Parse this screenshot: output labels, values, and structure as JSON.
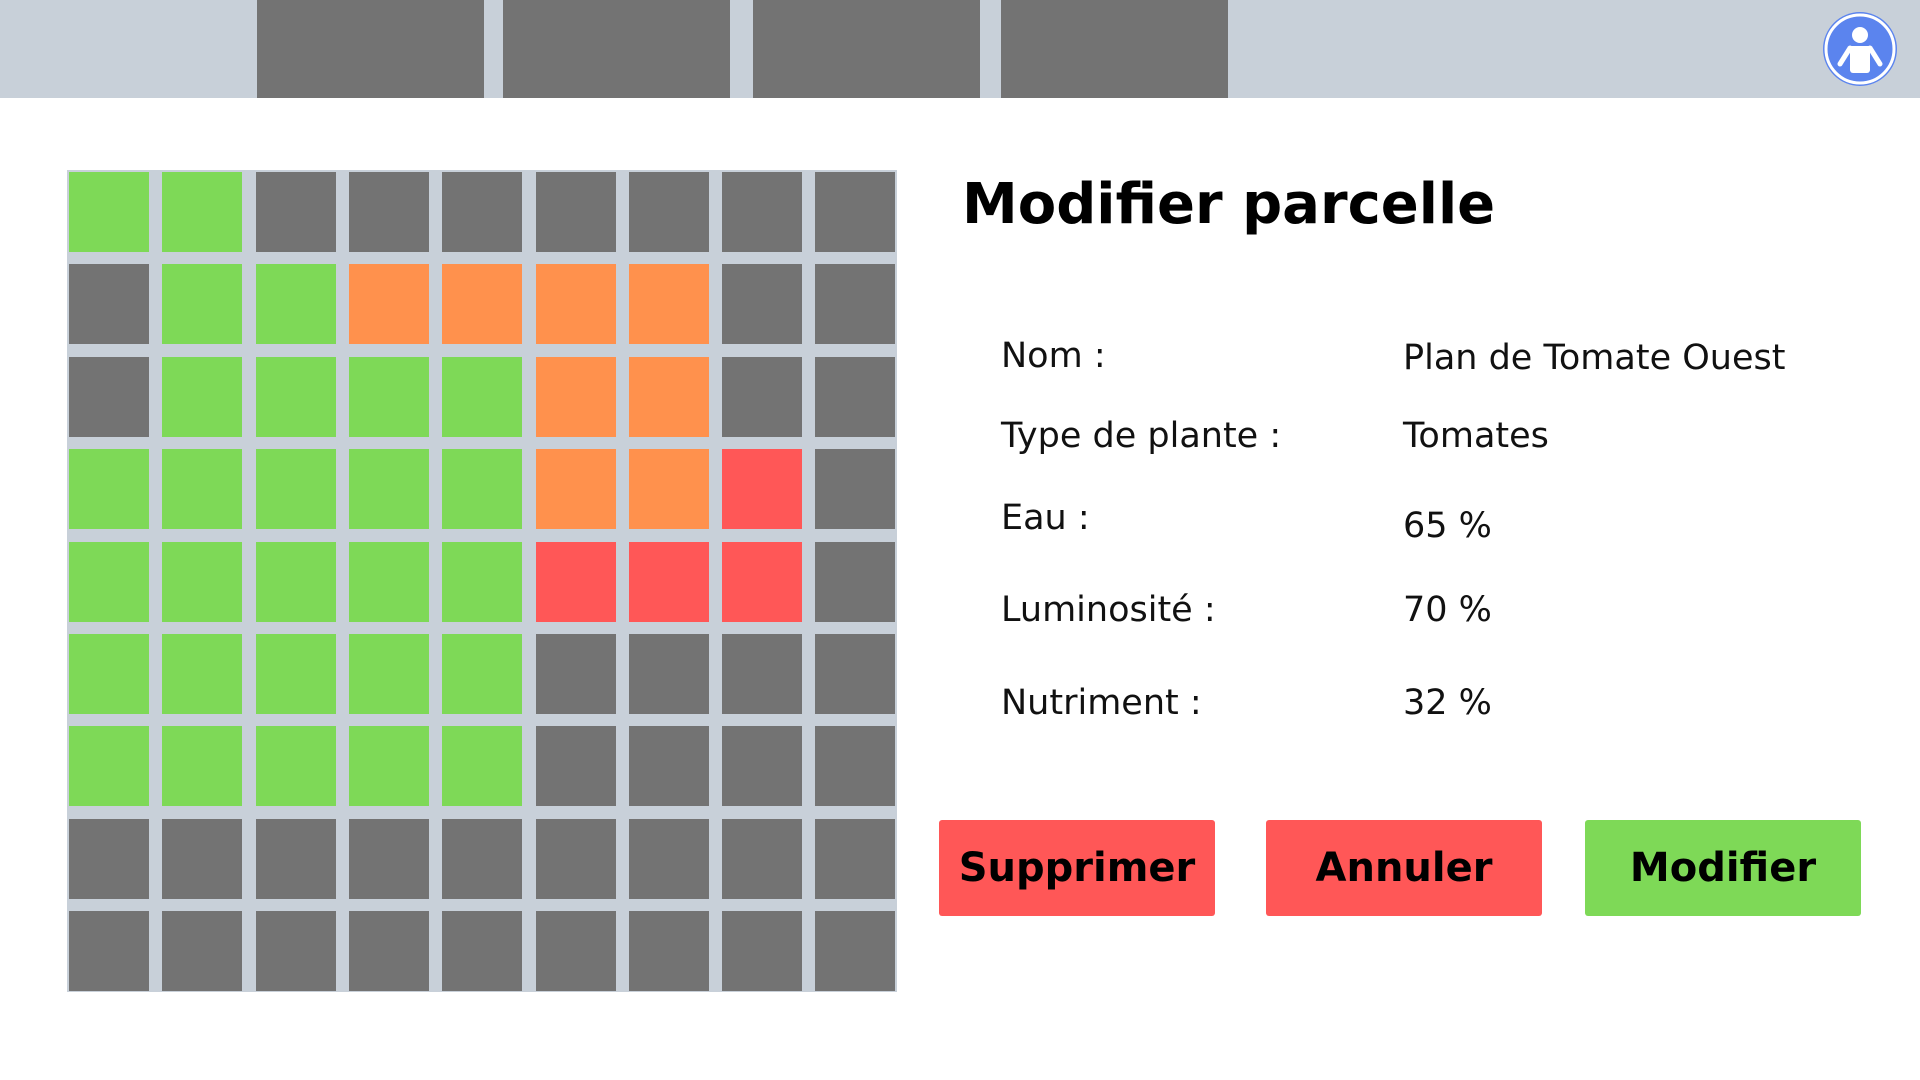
{
  "nav": {
    "tabs": [
      {
        "label": ""
      },
      {
        "label": ""
      },
      {
        "label": ""
      },
      {
        "label": ""
      }
    ]
  },
  "colors": {
    "green": "#7ed957",
    "orange": "#ff914d",
    "red": "#ff5757",
    "gray": "#737373",
    "avatar": "#5b84ee",
    "topbar": "#c8d0d9"
  },
  "plot_grid": {
    "rows": [
      [
        "green",
        "green",
        "gray",
        "gray",
        "gray",
        "gray",
        "gray",
        "gray",
        "gray"
      ],
      [
        "gray",
        "green",
        "green",
        "orange",
        "orange",
        "orange",
        "orange",
        "gray",
        "gray"
      ],
      [
        "gray",
        "green",
        "green",
        "green",
        "green",
        "orange",
        "orange",
        "gray",
        "gray"
      ],
      [
        "green",
        "green",
        "green",
        "green",
        "green",
        "orange",
        "orange",
        "red",
        "gray"
      ],
      [
        "green",
        "green",
        "green",
        "green",
        "green",
        "red",
        "red",
        "red",
        "gray"
      ],
      [
        "green",
        "green",
        "green",
        "green",
        "green",
        "gray",
        "gray",
        "gray",
        "gray"
      ],
      [
        "green",
        "green",
        "green",
        "green",
        "green",
        "gray",
        "gray",
        "gray",
        "gray"
      ],
      [
        "gray",
        "gray",
        "gray",
        "gray",
        "gray",
        "gray",
        "gray",
        "gray",
        "gray"
      ],
      [
        "gray",
        "gray",
        "gray",
        "gray",
        "gray",
        "gray",
        "gray",
        "gray",
        "gray"
      ]
    ]
  },
  "form": {
    "title": "Modifier parcelle",
    "fields": [
      {
        "label": "Nom :",
        "value": "Plan de Tomate Ouest"
      },
      {
        "label": "Type de plante :",
        "value": "Tomates"
      },
      {
        "label": "Eau :",
        "value": "65 %"
      },
      {
        "label": "Luminosité :",
        "value": "70 %"
      },
      {
        "label": "Nutriment :",
        "value": "32 %"
      }
    ]
  },
  "buttons": {
    "delete": "Supprimer",
    "cancel": "Annuler",
    "modify": "Modifier"
  },
  "icons": {
    "avatar": "user-icon"
  }
}
